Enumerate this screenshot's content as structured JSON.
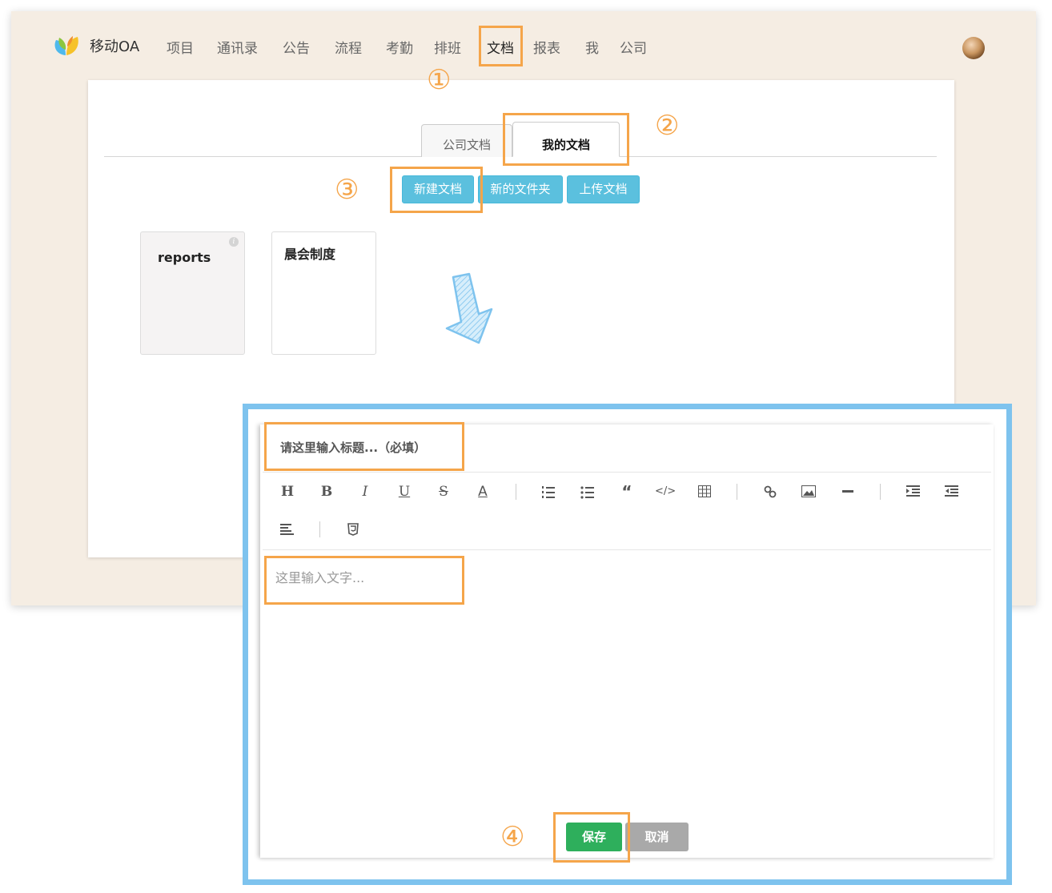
{
  "colors": {
    "accent_orange": "#f5a54a",
    "button_blue": "#5bc0de",
    "editor_border": "#7ec3ee",
    "save_green": "#2eaf5c",
    "cancel_gray": "#a9a9a9",
    "app_background": "#f5ede3"
  },
  "header": {
    "brand": "移动OA",
    "logo_icon": "colorful-leaf-logo",
    "nav": [
      "项目",
      "通讯录",
      "公告",
      "流程",
      "考勤",
      "排班",
      "文档",
      "报表",
      "我",
      "公司"
    ],
    "active_nav": "文档",
    "avatar_icon": "user-avatar"
  },
  "tabs": [
    "公司文档",
    "我的文档"
  ],
  "active_tab": "我的文档",
  "actions": {
    "new_doc": "新建文档",
    "new_folder": "新的文件夹",
    "upload_doc": "上传文档"
  },
  "folders": [
    {
      "name": "reports",
      "info_icon": "info-icon"
    },
    {
      "name": "晨会制度"
    }
  ],
  "editor": {
    "title_placeholder": "请这里输入标题...（必填）",
    "body_placeholder": "这里输入文字...",
    "toolbar": [
      "heading-icon",
      "bold-icon",
      "italic-icon",
      "underline-icon",
      "strikethrough-icon",
      "font-color-icon",
      "ordered-list-icon",
      "unordered-list-icon",
      "quote-icon",
      "code-icon",
      "table-icon",
      "link-icon",
      "image-icon",
      "horizontal-rule-icon",
      "indent-icon",
      "outdent-icon",
      "align-left-icon",
      "html5-icon"
    ],
    "save": "保存",
    "cancel": "取消"
  },
  "annotations": {
    "steps": [
      "①",
      "②",
      "③",
      "④"
    ]
  }
}
